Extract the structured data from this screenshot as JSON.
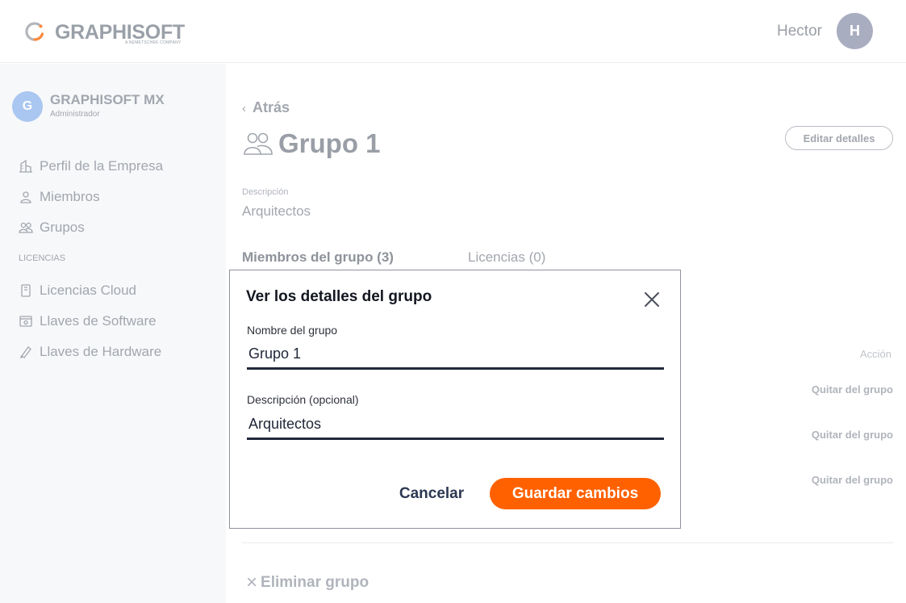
{
  "header": {
    "logo_text": "GRAPHISOFT",
    "logo_subtext": "A NEMETSCHEK COMPANY",
    "user_name": "Hector",
    "user_initial": "H",
    "brand_color": "#ff6100"
  },
  "sidebar": {
    "org": {
      "initial": "G",
      "name": "GRAPHISOFT MX",
      "role": "Administrador"
    },
    "items": [
      {
        "label": "Perfil de la Empresa",
        "icon": "building-icon"
      },
      {
        "label": "Miembros",
        "icon": "person-icon"
      },
      {
        "label": "Grupos",
        "icon": "group-icon"
      }
    ],
    "section_label": "LICENCIAS",
    "license_items": [
      {
        "label": "Licencias Cloud",
        "icon": "cloud-license-icon"
      },
      {
        "label": "Llaves de Software",
        "icon": "software-key-icon"
      },
      {
        "label": "Llaves de Hardware",
        "icon": "hardware-key-icon"
      }
    ]
  },
  "main": {
    "back_label": "Atrás",
    "group_title": "Grupo 1",
    "edit_button": "Editar detalles",
    "description_label": "Descripción",
    "description_value": "Arquitectos",
    "tabs": [
      {
        "label": "Miembros del grupo (3)",
        "active": true
      },
      {
        "label": "Licencias (0)",
        "active": false
      }
    ],
    "action_column": "Acción",
    "rows": [
      {
        "action": "Quitar del grupo"
      },
      {
        "action": "Quitar del grupo"
      },
      {
        "action": "Quitar del grupo"
      }
    ],
    "delete_group": "Eliminar grupo"
  },
  "modal": {
    "title": "Ver los detalles del grupo",
    "name_label": "Nombre del grupo",
    "name_value": "Grupo 1",
    "description_label": "Descripción (opcional)",
    "description_value": "Arquitectos",
    "cancel_label": "Cancelar",
    "save_label": "Guardar cambios"
  }
}
